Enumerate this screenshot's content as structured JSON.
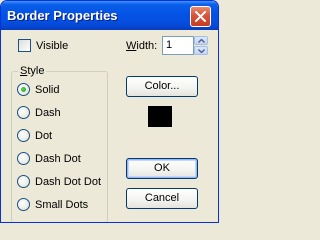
{
  "window": {
    "title": "Border Properties"
  },
  "visible_checkbox": {
    "label": "Visible",
    "checked": false
  },
  "width": {
    "label": "Width:",
    "value": "1"
  },
  "style_group": {
    "title": "Style",
    "options": [
      {
        "label": "Solid",
        "checked": true
      },
      {
        "label": "Dash",
        "checked": false
      },
      {
        "label": "Dot",
        "checked": false
      },
      {
        "label": "Dash Dot",
        "checked": false
      },
      {
        "label": "Dash Dot Dot",
        "checked": false
      },
      {
        "label": "Small Dots",
        "checked": false
      }
    ]
  },
  "color": {
    "button_label": "Color...",
    "swatch_color": "#000000"
  },
  "buttons": {
    "ok": "OK",
    "cancel": "Cancel"
  },
  "icons": {
    "close": "close-icon",
    "spin_up": "chevron-up-icon",
    "spin_down": "chevron-down-icon"
  }
}
